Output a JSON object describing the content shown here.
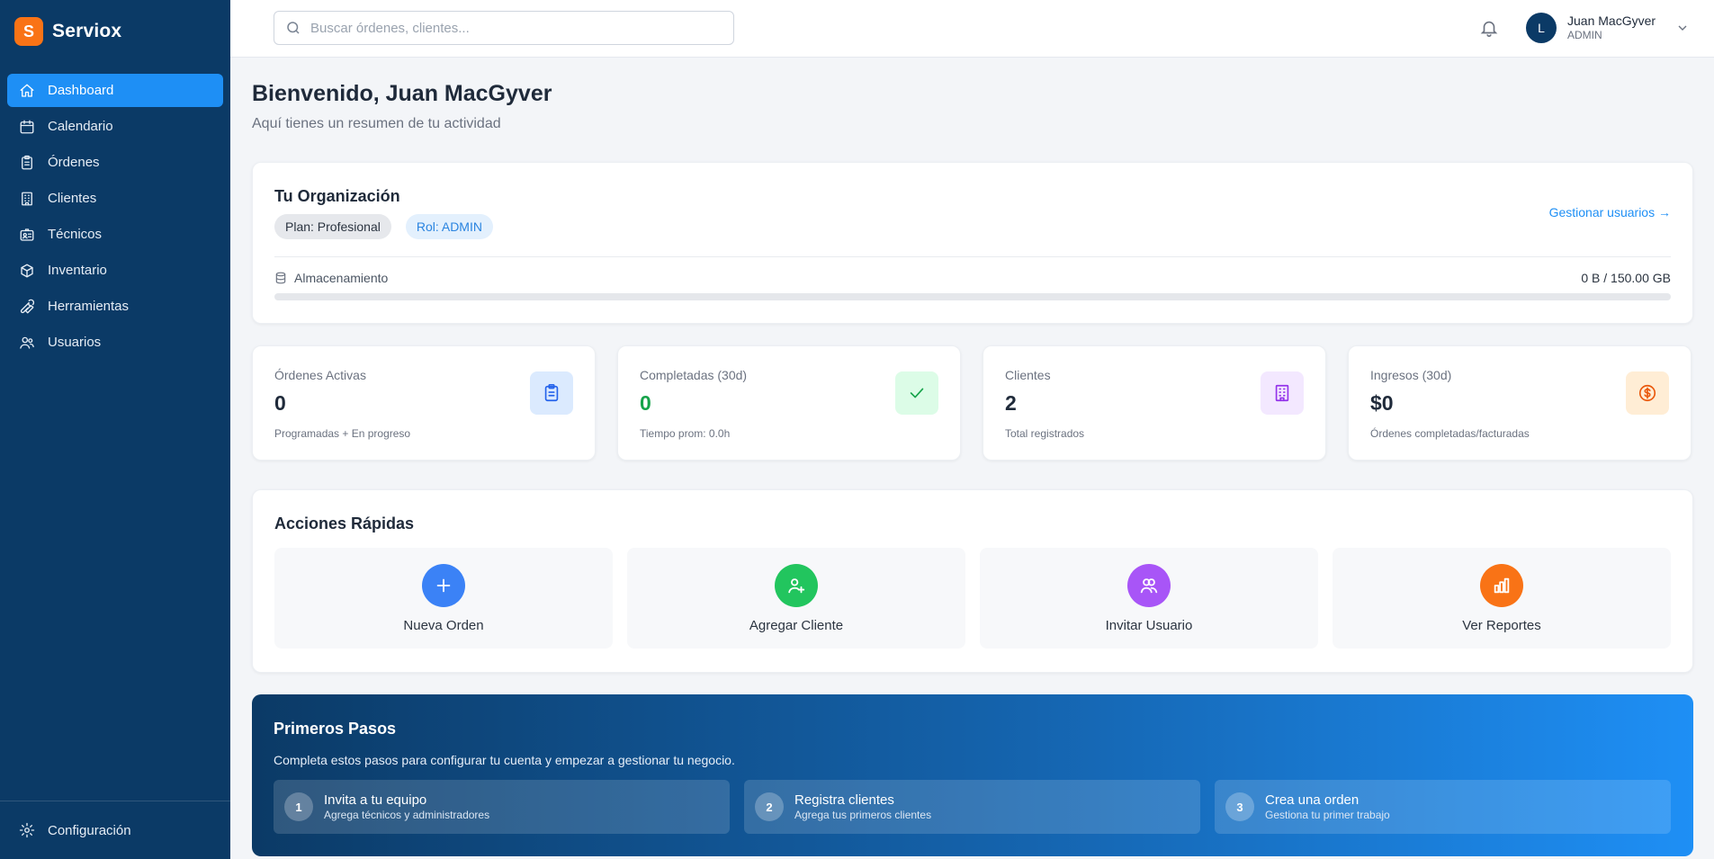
{
  "brand": {
    "logo_letter": "S",
    "name": "Serviox",
    "logo_color": "#f97316"
  },
  "sidebar": {
    "items": [
      {
        "label": "Dashboard",
        "icon": "home-icon",
        "active": true
      },
      {
        "label": "Calendario",
        "icon": "calendar-icon"
      },
      {
        "label": "Órdenes",
        "icon": "clipboard-icon"
      },
      {
        "label": "Clientes",
        "icon": "building-icon"
      },
      {
        "label": "Técnicos",
        "icon": "id-card-icon"
      },
      {
        "label": "Inventario",
        "icon": "box-icon"
      },
      {
        "label": "Herramientas",
        "icon": "wrench-icon"
      },
      {
        "label": "Usuarios",
        "icon": "users-icon"
      }
    ],
    "footer": {
      "label": "Configuración",
      "icon": "gear-icon"
    },
    "background": "#0b3a66",
    "active_color": "#1e8ff5"
  },
  "topbar": {
    "search_placeholder": "Buscar órdenes, clientes...",
    "user": {
      "initial": "L",
      "name": "Juan MacGyver",
      "role": "ADMIN"
    }
  },
  "main": {
    "welcome": "Bienvenido, Juan MacGyver",
    "subtitle": "Aquí tienes un resumen de tu actividad",
    "organization": {
      "title": "Tu Organización",
      "plan": "Plan: Profesional",
      "role": "Rol: ADMIN",
      "manage_link": "Gestionar usuarios →",
      "storage_label": "Almacenamiento",
      "storage_value": "0 B / 150.00 GB",
      "storage_fraction": 0
    },
    "stats": [
      {
        "label": "Órdenes Activas",
        "value": "0",
        "note": "Programadas + En progreso",
        "icon": "clipboard-icon",
        "icon_bg": "#dbeafe",
        "icon_color": "#2563eb"
      },
      {
        "label": "Completadas (30d)",
        "value": "0",
        "note": "Tiempo prom: 0.0h",
        "icon": "check-icon",
        "icon_bg": "#dcfce7",
        "icon_color": "#16a34a"
      },
      {
        "label": "Clientes",
        "value": "2",
        "note": "Total registrados",
        "icon": "building-icon",
        "icon_bg": "#f3e8ff",
        "icon_color": "#9333ea"
      },
      {
        "label": "Ingresos (30d)",
        "value": "$0",
        "note": "Órdenes completadas/facturadas",
        "icon": "dollar-icon",
        "icon_bg": "#ffedd5",
        "icon_color": "#ea580c"
      }
    ],
    "quick_actions": {
      "title": "Acciones Rápidas",
      "items": [
        {
          "label": "Nueva Orden",
          "icon": "plus-icon",
          "color": "#3b82f6"
        },
        {
          "label": "Agregar Cliente",
          "icon": "user-plus-icon",
          "color": "#22c55e"
        },
        {
          "label": "Invitar Usuario",
          "icon": "users-icon",
          "color": "#a855f7"
        },
        {
          "label": "Ver Reportes",
          "icon": "bar-chart-icon",
          "color": "#f97316"
        }
      ]
    },
    "getting_started": {
      "title": "Primeros Pasos",
      "description": "Completa estos pasos para configurar tu cuenta y empezar a gestionar tu negocio.",
      "steps": [
        {
          "number": "1",
          "title": "Invita a tu equipo",
          "desc": "Agrega técnicos y administradores"
        },
        {
          "number": "2",
          "title": "Registra clientes",
          "desc": "Agrega tus primeros clientes"
        },
        {
          "number": "3",
          "title": "Crea una orden",
          "desc": "Gestiona tu primer trabajo"
        }
      ]
    }
  }
}
